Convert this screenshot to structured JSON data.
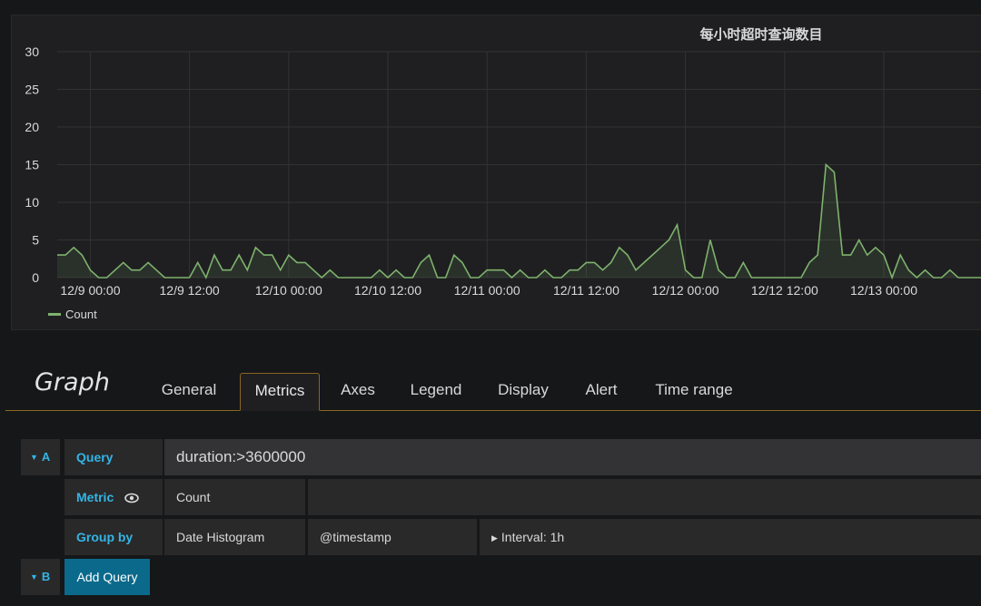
{
  "panel": {
    "title": "每小时超时查询数目"
  },
  "chart_data": {
    "type": "area",
    "title": "每小时超时查询数目",
    "x_ticks": [
      "12/9 00:00",
      "12/9 12:00",
      "12/10 00:00",
      "12/10 12:00",
      "12/11 00:00",
      "12/11 12:00",
      "12/12 00:00",
      "12/12 12:00",
      "12/13 00:00"
    ],
    "y_ticks": [
      "0",
      "5",
      "10",
      "15",
      "20",
      "25",
      "30"
    ],
    "ylim": [
      0,
      30
    ],
    "x_start": "12/8 20:00",
    "x_interval": "1h",
    "grid": true,
    "legend_position": "bottom-left",
    "series": [
      {
        "name": "Count",
        "color": "#7eb26d",
        "values": [
          3,
          3,
          4,
          3,
          1,
          0,
          0,
          1,
          2,
          1,
          1,
          2,
          1,
          0,
          0,
          0,
          0,
          2,
          0,
          3,
          1,
          1,
          3,
          1,
          4,
          3,
          3,
          1,
          3,
          2,
          2,
          1,
          0,
          1,
          0,
          0,
          0,
          0,
          0,
          1,
          0,
          1,
          0,
          0,
          2,
          3,
          0,
          0,
          3,
          2,
          0,
          0,
          1,
          1,
          1,
          0,
          1,
          0,
          0,
          1,
          0,
          0,
          1,
          1,
          2,
          2,
          1,
          2,
          4,
          3,
          1,
          2,
          3,
          4,
          5,
          7,
          1,
          0,
          0,
          5,
          1,
          0,
          0,
          2,
          0,
          0,
          0,
          0,
          0,
          0,
          0,
          2,
          3,
          15,
          14,
          3,
          3,
          5,
          3,
          4,
          3,
          0,
          3,
          1,
          0,
          1,
          0,
          0,
          1,
          0,
          0,
          0,
          0,
          0,
          2,
          0
        ]
      }
    ]
  },
  "legend": {
    "series_name": "Count"
  },
  "editor": {
    "title": "Graph",
    "tabs": [
      {
        "label": "General"
      },
      {
        "label": "Metrics"
      },
      {
        "label": "Axes"
      },
      {
        "label": "Legend"
      },
      {
        "label": "Display"
      },
      {
        "label": "Alert"
      },
      {
        "label": "Time range"
      }
    ],
    "active_tab": "Metrics"
  },
  "query_a": {
    "letter": "A",
    "query_label": "Query",
    "query_value": "duration:>3600000",
    "metric_label": "Metric",
    "metric_value": "Count",
    "group_by_label": "Group by",
    "group_by_value": "Date Histogram",
    "group_by_field": "@timestamp",
    "interval": "Interval: 1h"
  },
  "query_b": {
    "letter": "B",
    "add_query_label": "Add Query"
  },
  "colors": {
    "accent": "#33b5e5",
    "series": "#7eb26d",
    "tab_border": "#886522",
    "button": "#0b6a8c"
  }
}
